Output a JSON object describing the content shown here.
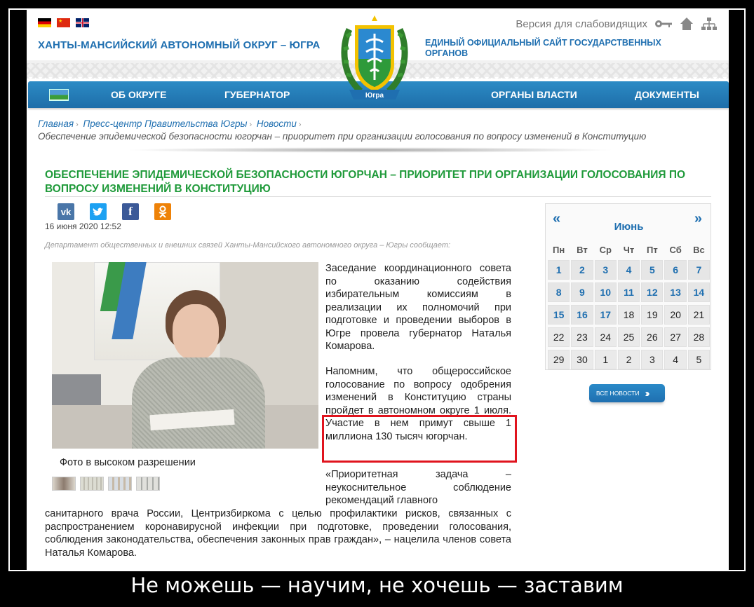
{
  "header": {
    "flags": [
      "de",
      "cn",
      "gb"
    ],
    "site_title": "ХАНТЫ-МАНСИЙСКИЙ АВТОНОМНЫЙ ОКРУГ – ЮГРА",
    "site_subtitle": "ЕДИНЫЙ ОФИЦИАЛЬНЫЙ САЙТ ГОСУДАРСТВЕННЫХ ОРГАНОВ",
    "accessibility_label": "Версия для слабовидящих",
    "emblem_text": "Югра",
    "icons": [
      "key-icon",
      "home-icon",
      "sitemap-icon"
    ]
  },
  "nav": {
    "items": [
      "ОБ ОКРУГЕ",
      "ГУБЕРНАТОР",
      "ОРГАНЫ ВЛАСТИ",
      "ДОКУМЕНТЫ"
    ]
  },
  "breadcrumb": {
    "items": [
      "Главная",
      "Пресс-центр Правительства Югры",
      "Новости"
    ],
    "current": "Обеспечение эпидемической безопасности югорчан – приоритет при организации голосования по вопросу изменений в Конституцию"
  },
  "article": {
    "title": "ОБЕСПЕЧЕНИЕ ЭПИДЕМИЧЕСКОЙ БЕЗОПАСНОСТИ ЮГОРЧАН – ПРИОРИТЕТ ПРИ ОРГАНИЗАЦИИ ГОЛОСОВАНИЯ ПО ВОПРОСУ ИЗМЕНЕНИЙ В КОНСТИТУЦИЮ",
    "share": [
      "vk-icon",
      "twitter-icon",
      "facebook-icon",
      "odnoklassniki-icon"
    ],
    "date": "16 июня 2020 12:52",
    "source": "Департамент общественных и внешних связей Ханты-Мансийского автономного округа – Югры сообщает:",
    "photo_caption": "Фото в высоком разрешении",
    "p1": "Заседание координационного совета по оказанию содействия избирательным комиссиям в реализации их полномочий при подготовке и проведении выборов в Югре провела губернатор Наталья Комарова.",
    "p2": "Напомним, что общероссийское голосование по вопросу одобрения изменений в Конституцию страны пройдет в автономном округе 1 июля. Участие в нем примут свыше 1 миллиона 130 тысяч югорчан.",
    "p3a": "«Приоритетная задача – неукоснительное соблюдение рекомендаций главного",
    "p3b": "санитарного врача России, Центризбиркома с целью профилактики рисков, связанных с распространением коронавирусной инфекции при подготовке, проведении голосования, соблюдения законодательства, обеспечения законных прав граждан», – нацелила членов совета Наталья Комарова.",
    "highlight_color": "#e0141e"
  },
  "calendar": {
    "prev": "«",
    "next": "»",
    "month": "Июнь",
    "weekdays": [
      "Пн",
      "Вт",
      "Ср",
      "Чт",
      "Пт",
      "Сб",
      "Вс"
    ],
    "days": [
      {
        "d": "1",
        "link": true
      },
      {
        "d": "2",
        "link": true
      },
      {
        "d": "3",
        "link": true
      },
      {
        "d": "4",
        "link": true
      },
      {
        "d": "5",
        "link": true
      },
      {
        "d": "6",
        "link": true
      },
      {
        "d": "7",
        "link": true
      },
      {
        "d": "8",
        "link": true
      },
      {
        "d": "9",
        "link": true
      },
      {
        "d": "10",
        "link": true
      },
      {
        "d": "11",
        "link": true
      },
      {
        "d": "12",
        "link": true
      },
      {
        "d": "13",
        "link": true
      },
      {
        "d": "14",
        "link": true
      },
      {
        "d": "15",
        "link": true
      },
      {
        "d": "16",
        "link": true
      },
      {
        "d": "17",
        "link": true
      },
      {
        "d": "18",
        "link": false
      },
      {
        "d": "19",
        "link": false
      },
      {
        "d": "20",
        "link": false
      },
      {
        "d": "21",
        "link": false
      },
      {
        "d": "22",
        "link": false
      },
      {
        "d": "23",
        "link": false
      },
      {
        "d": "24",
        "link": false
      },
      {
        "d": "25",
        "link": false
      },
      {
        "d": "26",
        "link": false
      },
      {
        "d": "27",
        "link": false
      },
      {
        "d": "28",
        "link": false
      },
      {
        "d": "29",
        "link": false
      },
      {
        "d": "30",
        "link": false
      },
      {
        "d": "1",
        "link": false
      },
      {
        "d": "2",
        "link": false
      },
      {
        "d": "3",
        "link": false
      },
      {
        "d": "4",
        "link": false
      },
      {
        "d": "5",
        "link": false
      }
    ],
    "all_news": "все новости"
  },
  "meme_caption": "Не можешь — научим, не хочешь — заставим",
  "colors": {
    "brand_blue": "#1f6fb0",
    "title_green": "#1f9a3a",
    "nav_blue": "#2c8bc5"
  }
}
